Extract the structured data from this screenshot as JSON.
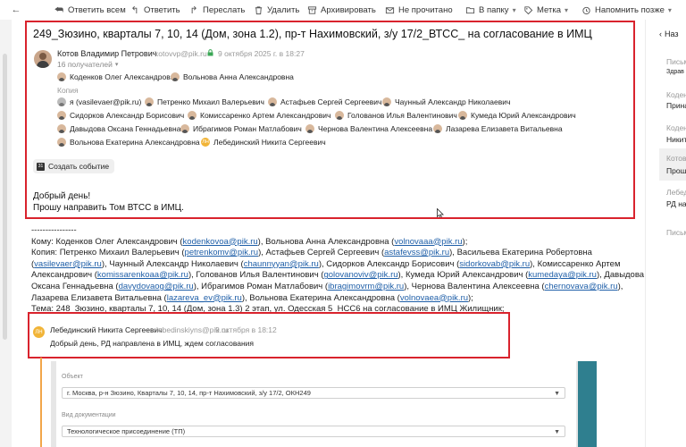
{
  "toolbar": {
    "reply_all": "Ответить всем",
    "reply": "Ответить",
    "forward": "Переслать",
    "delete": "Удалить",
    "archive": "Архивировать",
    "unread": "Не прочитано",
    "to_folder": "В папку",
    "label": "Метка",
    "remind": "Напомнить позже"
  },
  "mail": {
    "title": "249_Зюзино, кварталы 7, 10, 14 (Дом, зона 1.2), пр-т Нахимовский, з/у 17/2_ВТСС_ на согласование в ИМЦ",
    "sender_name": "Котов Владимир Петрович",
    "sender_email": "kotovvp@pik.ru",
    "date": "9 октября 2025 г. в 18:27",
    "recipients_count": "16 получателей",
    "to": [
      "Коденков Олег Александрович",
      "Вольнова Анна Александровна"
    ],
    "copy_label": "Копия",
    "cc_row1": [
      "я (vasilevaer@pik.ru)",
      "Петренко Михаил Валерьевич",
      "Астафьев Сергей Сергеевич",
      "Чаунный Александр Николаевич"
    ],
    "cc_row2": [
      "Сидорков Александр Борисович",
      "Комиссаренко Артем Александрович",
      "Голованов Илья Валентинович",
      "Кумеда Юрий Александрович"
    ],
    "cc_row3": [
      "Давыдова Оксана Геннадьевна",
      "Ибрагимов Роман Матлабович",
      "Чернова Валентина Алексеевна",
      "Лазарева Елизавета Витальевна"
    ],
    "cc_row4": [
      "Вольнова Екатерина Александровна",
      "Лебединский Никита Сергеевич"
    ],
    "ln_initials": "ЛН",
    "create_event": "Создать событие",
    "body_line1": "Добрый день!",
    "body_line2": "Прошу направить Том ВТСС в ИМЦ."
  },
  "quote": {
    "separator": "----------------",
    "kodenkov_email": "kodenkovoa@pik.ru",
    "volnova_email": "volnovaaa@pik.ru",
    "petrenko_email": "petrenkomv@pik.ru",
    "astafiev_email": "astafevss@pik.ru",
    "vasileva_email": "vasilevaer@pik.ru",
    "chaunny_email": "chaunnyyan@pik.ru",
    "sidorkov_email": "sidorkovab@pik.ru",
    "komissarenko_email": "komissarenkoaa@pik.ru",
    "golovanov_email": "golovanoviv@pik.ru",
    "kumeda_email": "kumedaya@pik.ru",
    "davydova_email": "davydovaog@pik.ru",
    "ibragimov_email": "ibragimovrm@pik.ru",
    "chernova_email": "chernovava@pik.ru",
    "lazareva_email": "lazareva_ev@pik.ru",
    "volnova_e_email": "volnovaea@pik.ru",
    "t_to": "Кому: Коденков Олег Александрович (",
    "t_to2": "), Вольнова Анна Александровна (",
    "t_close": ");",
    "t_cc": "Копия: Петренко Михаил Валерьевич (",
    "t_cc2": "), Астафьев Сергей Сергеевич (",
    "t_cc3": "), Васильева Екатерина Робертовна",
    "t_cc4": "(",
    "t_cc5": "), Чаунный Александр Николаевич (",
    "t_cc6": "), Сидорков Александр Борисович (",
    "t_cc7": "), Комиссаренко Артем",
    "t_cc8": "Александрович (",
    "t_cc9": "), Голованов Илья Валентинович (",
    "t_cc10": "), Кумеда Юрий Александрович (",
    "t_cc11": "), Давыдова",
    "t_cc12": "Оксана Геннадьевна (",
    "t_cc13": "), Ибрагимов Роман Матлабович (",
    "t_cc14": "), Чернова Валентина Алексеевна (",
    "t_cc15": "),",
    "t_cc16": "Лазарева Елизавета Витальевна (",
    "t_cc17": "), Вольнова Екатерина Александровна (",
    "t_subject": "Тема: 248_Зюзино, кварталы 7, 10, 14 (Дом, зона 1.3) 2 этап, ул. Одесская 5_НСС6 на согласование в ИМЦ Жилищник;"
  },
  "reply": {
    "initials": "ЛН",
    "name": "Лебединский Никита Сергеевич",
    "email": "lebedinskiyns@pik.ru",
    "date": "9 октября в 18:12",
    "text": "Добрый день, РД направлена в ИМЦ, ждем согласования"
  },
  "form": {
    "object_label": "Объект",
    "object_value": "г. Москва, р-н Зюзино, Кварталы 7, 10, 14, пр-т Нахимовский, з/у 17/2, ОКН249",
    "doc_label": "Вид документации",
    "doc_value": "Технологическое присоединение (ТП)"
  },
  "right_panel": {
    "back": "Наз",
    "items": [
      {
        "label": "Письм",
        "value": "Здрав"
      },
      {
        "label": "Коден",
        "value": "Прина"
      },
      {
        "label": "Коден",
        "value": "Никит"
      },
      {
        "label": "Котов",
        "value": "Прошу"
      },
      {
        "label": "Лебед",
        "value": "РД на"
      },
      {
        "label": "Письм",
        "value": ""
      }
    ]
  },
  "colors": {
    "highlight_border": "#d9232d",
    "link": "#1f5fa8",
    "avatar_ln": "#f1b437",
    "form_teal": "#2f7f8f",
    "thread_line": "#f2a64a"
  }
}
